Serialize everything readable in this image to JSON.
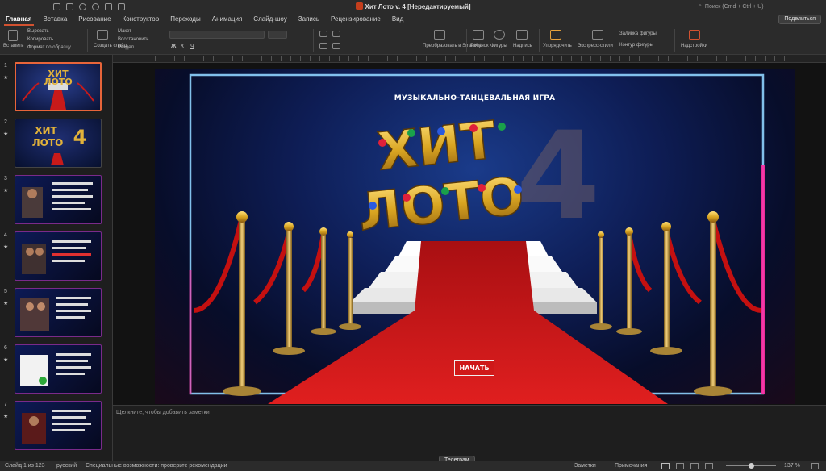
{
  "window": {
    "title": "Хит Лото v. 4 [Нередактируемый]",
    "search_placeholder": "Поиск (Cmd + Ctrl + U)"
  },
  "menu": {
    "tabs": [
      "Главная",
      "Вставка",
      "Рисование",
      "Конструктор",
      "Переходы",
      "Анимация",
      "Слайд-шоу",
      "Запись",
      "Рецензирование",
      "Вид"
    ],
    "active_tab": "Главная",
    "share_label": "Поделиться"
  },
  "ribbon": {
    "paste": "Вставить",
    "cut": "Вырезать",
    "copy": "Копировать",
    "format_painter": "Формат по образцу",
    "new_slide": "Создать слайд",
    "layout": "Макет",
    "reset": "Восстановить",
    "section": "Раздел",
    "convert_smartart": "Преобразовать в SmartArt",
    "picture": "Рисунок",
    "shapes": "Фигуры",
    "textbox": "Надпись",
    "arrange": "Упорядочить",
    "quick_styles": "Экспресс-стили",
    "shape_fill": "Заливка фигуры",
    "shape_outline": "Контур фигуры",
    "addins": "Надстройки"
  },
  "thumbnails": [
    {
      "num": "1",
      "star": "★",
      "selected": true
    },
    {
      "num": "2",
      "star": "★",
      "selected": false
    },
    {
      "num": "3",
      "star": "★",
      "selected": false
    },
    {
      "num": "4",
      "star": "★",
      "selected": false
    },
    {
      "num": "5",
      "star": "★",
      "selected": false
    },
    {
      "num": "6",
      "star": "★",
      "selected": false
    },
    {
      "num": "7",
      "star": "★",
      "selected": false
    }
  ],
  "slide": {
    "subtitle": "МУЗЫКАЛЬНО-ТАНЦЕВАЛЬНАЯ ИГРА",
    "title_line1": "ХИТ",
    "title_line2": "ЛОТО",
    "number": "4",
    "start_button": "НАЧАТЬ"
  },
  "notes_placeholder": "Щелкните, чтобы добавить заметки",
  "tooltip": "Телеграм",
  "statusbar": {
    "slide_info": "Слайд 1 из 123",
    "language": "русский",
    "accessibility": "Специальные возможности: проверьте рекомендации",
    "notes": "Заметки",
    "comments": "Примечания",
    "zoom": "137 %"
  },
  "colors": {
    "accent": "#d35230",
    "carpet": "#d01818",
    "gold": "#d9a521",
    "neon_blue": "#8fd4ff",
    "neon_pink": "#ff2aa0"
  }
}
